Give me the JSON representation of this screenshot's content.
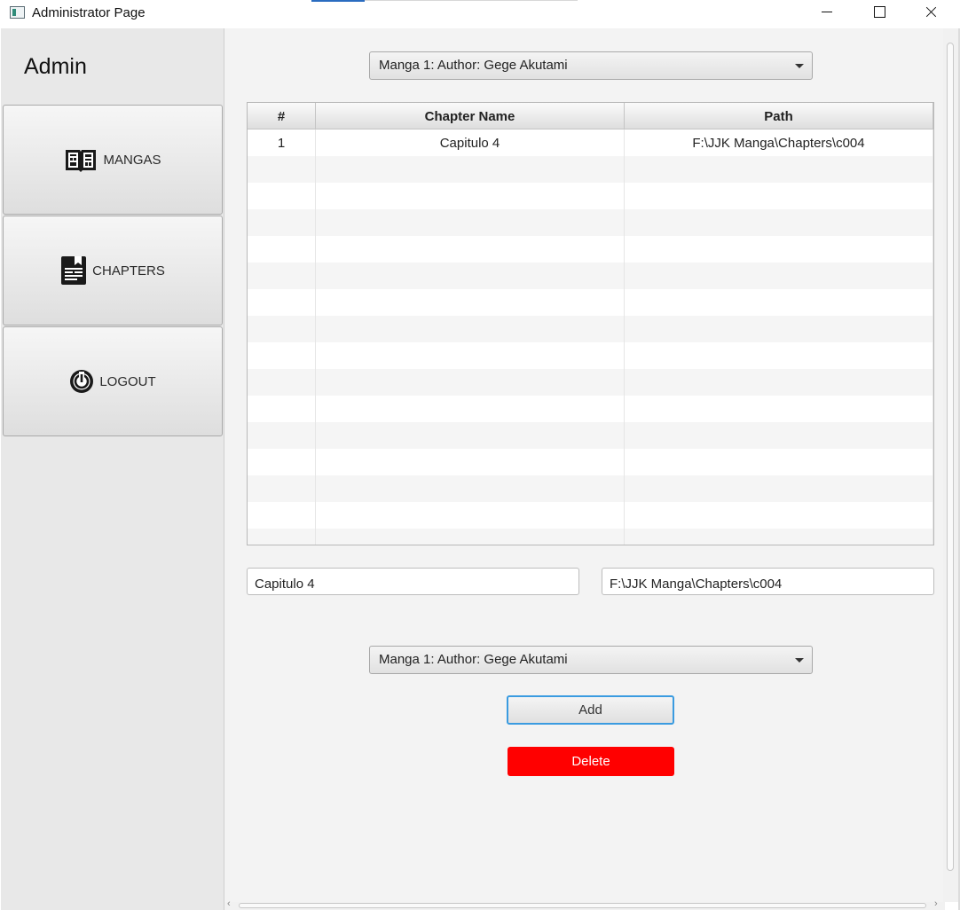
{
  "window": {
    "title": "Administrator Page"
  },
  "sidebar": {
    "title": "Admin",
    "items": [
      {
        "label": "MANGAS",
        "icon": "open-book-icon"
      },
      {
        "label": "CHAPTERS",
        "icon": "chapter-book-icon"
      },
      {
        "label": "LOGOUT",
        "icon": "power-icon"
      }
    ]
  },
  "main": {
    "manga_select": {
      "value": "Manga 1: Author: Gege Akutami"
    },
    "table": {
      "headers": [
        "#",
        "Chapter Name",
        "Path"
      ],
      "rows": [
        [
          "1",
          "Capitulo 4",
          "F:\\JJK Manga\\Chapters\\c004"
        ]
      ]
    },
    "form": {
      "chapter_name": "Capitulo 4",
      "path": "F:\\JJK Manga\\Chapters\\c004",
      "manga_select": "Manga 1: Author: Gege Akutami",
      "add_label": "Add",
      "delete_label": "Delete"
    }
  },
  "colors": {
    "delete": "#ff0000",
    "focus": "#3a9be0"
  }
}
